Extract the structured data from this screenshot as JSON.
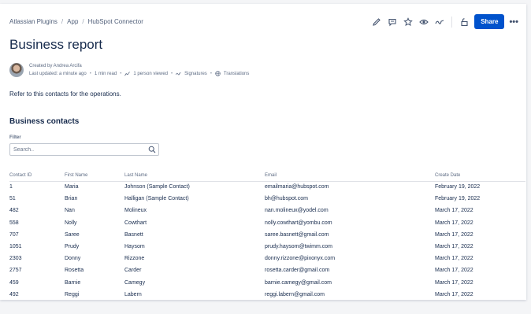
{
  "breadcrumb": [
    "Atlassian Plugins",
    "App",
    "HubSpot Connector"
  ],
  "toolbar": {
    "icons": [
      "edit-icon",
      "comment-icon",
      "star-icon",
      "watch-icon",
      "signature-icon",
      "restrictions-icon"
    ],
    "share_label": "Share",
    "more_label": "•••"
  },
  "page": {
    "title": "Business report",
    "created_by": "Created by Andrea Arcifa",
    "last_updated": "Last updated: a minute ago",
    "read_time": "1 min read",
    "viewed": "1 person viewed",
    "signatures": "Signatures",
    "translations": "Translations",
    "intro": "Refer to this contacts for the operations."
  },
  "contacts": {
    "heading": "Business contacts",
    "filter_label": "Filter",
    "search_placeholder": "Search..",
    "columns": [
      "Contact ID",
      "First Name",
      "Last Name",
      "Email",
      "Create Date"
    ],
    "rows": [
      [
        "1",
        "Maria",
        "Johnson (Sample Contact)",
        "emailmaria@hubspot.com",
        "February 19, 2022"
      ],
      [
        "51",
        "Brian",
        "Halligan (Sample Contact)",
        "bh@hubspot.com",
        "February 19, 2022"
      ],
      [
        "482",
        "Nan",
        "Molineux",
        "nan.molineux@yodel.com",
        "March 17, 2022"
      ],
      [
        "558",
        "Nolly",
        "Cowthart",
        "nolly.cowthart@yombu.com",
        "March 17, 2022"
      ],
      [
        "707",
        "Saree",
        "Basnett",
        "saree.basnett@gmail.com",
        "March 17, 2022"
      ],
      [
        "1051",
        "Prudy",
        "Haysom",
        "prudy.haysom@twimm.com",
        "March 17, 2022"
      ],
      [
        "2303",
        "Donny",
        "Rizzone",
        "donny.rizzone@pixonyx.com",
        "March 17, 2022"
      ],
      [
        "2757",
        "Rosetta",
        "Carder",
        "rosetta.carder@gmail.com",
        "March 17, 2022"
      ],
      [
        "459",
        "Barnie",
        "Camegy",
        "barnie.camegy@gmail.com",
        "March 17, 2022"
      ],
      [
        "492",
        "Reggi",
        "Labern",
        "reggi.labern@gmail.com",
        "March 17, 2022"
      ]
    ]
  },
  "colors": {
    "primary": "#0052cc",
    "text": "#172b4d",
    "subtle": "#5e6c84"
  }
}
